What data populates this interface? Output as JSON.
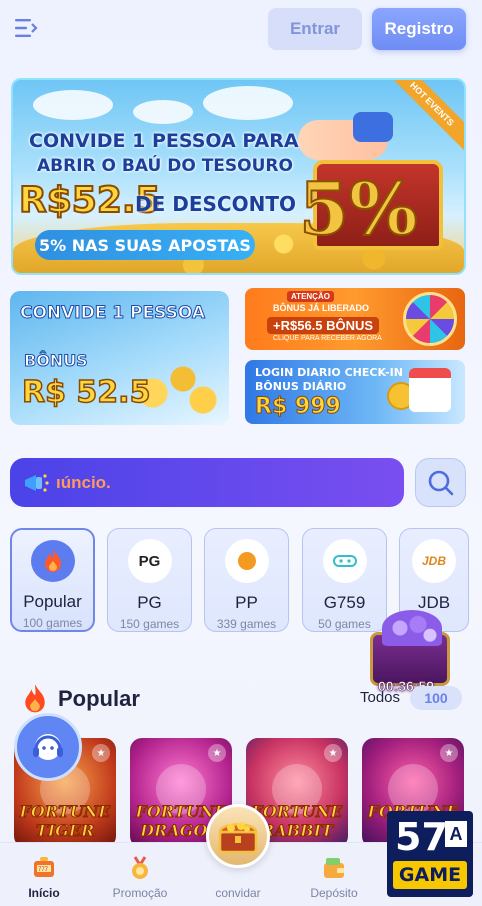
{
  "header": {
    "login_label": "Entrar",
    "register_label": "Registro"
  },
  "banner": {
    "line1": "CONVIDE 1 PESSOA PARA",
    "line2": "ABRIR O BAÚ DO TESOURO",
    "amount": "R$52.5",
    "discount": "DE DESCONTO",
    "pill": "5% NAS SUAS APOSTAS",
    "hot_tag": "HOT EVENTS",
    "percent": "5%"
  },
  "promo_left": {
    "title": "CONVIDE 1 PESSOA",
    "bonus_label": "BÔNUS",
    "amount": "R$ 52.5"
  },
  "promo_right_top": {
    "tag": "ATENÇÃO",
    "line1": "BÔNUS JÁ LIBERADO",
    "amount": "+R$56.5 BÔNUS",
    "cta": "CLIQUE PARA RECEBER AGORA"
  },
  "promo_right_bottom": {
    "line1": "LOGIN DIARIO CHECK-IN",
    "line2": "BÔNUS DIÁRIO",
    "amount": "R$ 999"
  },
  "marquee": {
    "text": "ıúncio."
  },
  "categories": [
    {
      "name": "Popular",
      "count": "100 games",
      "icon": "fire-icon"
    },
    {
      "name": "PG",
      "count": "150 games",
      "icon": "pg-logo-icon"
    },
    {
      "name": "PP",
      "count": "339 games",
      "icon": "pp-logo-icon"
    },
    {
      "name": "G759",
      "count": "50 games",
      "icon": "g759-logo-icon"
    },
    {
      "name": "JDB",
      "count": "",
      "icon": "jdb-logo-icon"
    }
  ],
  "float_chest": {
    "timer": "00:36:59"
  },
  "popular": {
    "title": "Popular",
    "all_label": "Todos",
    "all_count": "100",
    "games": [
      {
        "name": "FORTUNE TIGER"
      },
      {
        "name": "FORTUNE DRAGON"
      },
      {
        "name": "FORTUNE RABBIT"
      },
      {
        "name": "FORTUNE FROG"
      }
    ]
  },
  "bottom_nav": [
    {
      "label": "Início",
      "icon": "slot-machine-icon"
    },
    {
      "label": "Promoção",
      "icon": "medal-icon"
    },
    {
      "label": "convidar",
      "icon": "treasure-chest-icon"
    },
    {
      "label": "Depósito",
      "icon": "wallet-icon"
    }
  ],
  "logo": {
    "number": "57",
    "letter": "A",
    "word": "GAME"
  },
  "colors": {
    "accent": "#6f8cf4",
    "marquee": "#4a43e8",
    "gold": "#ffd640",
    "navy": "#0e1d5c"
  }
}
